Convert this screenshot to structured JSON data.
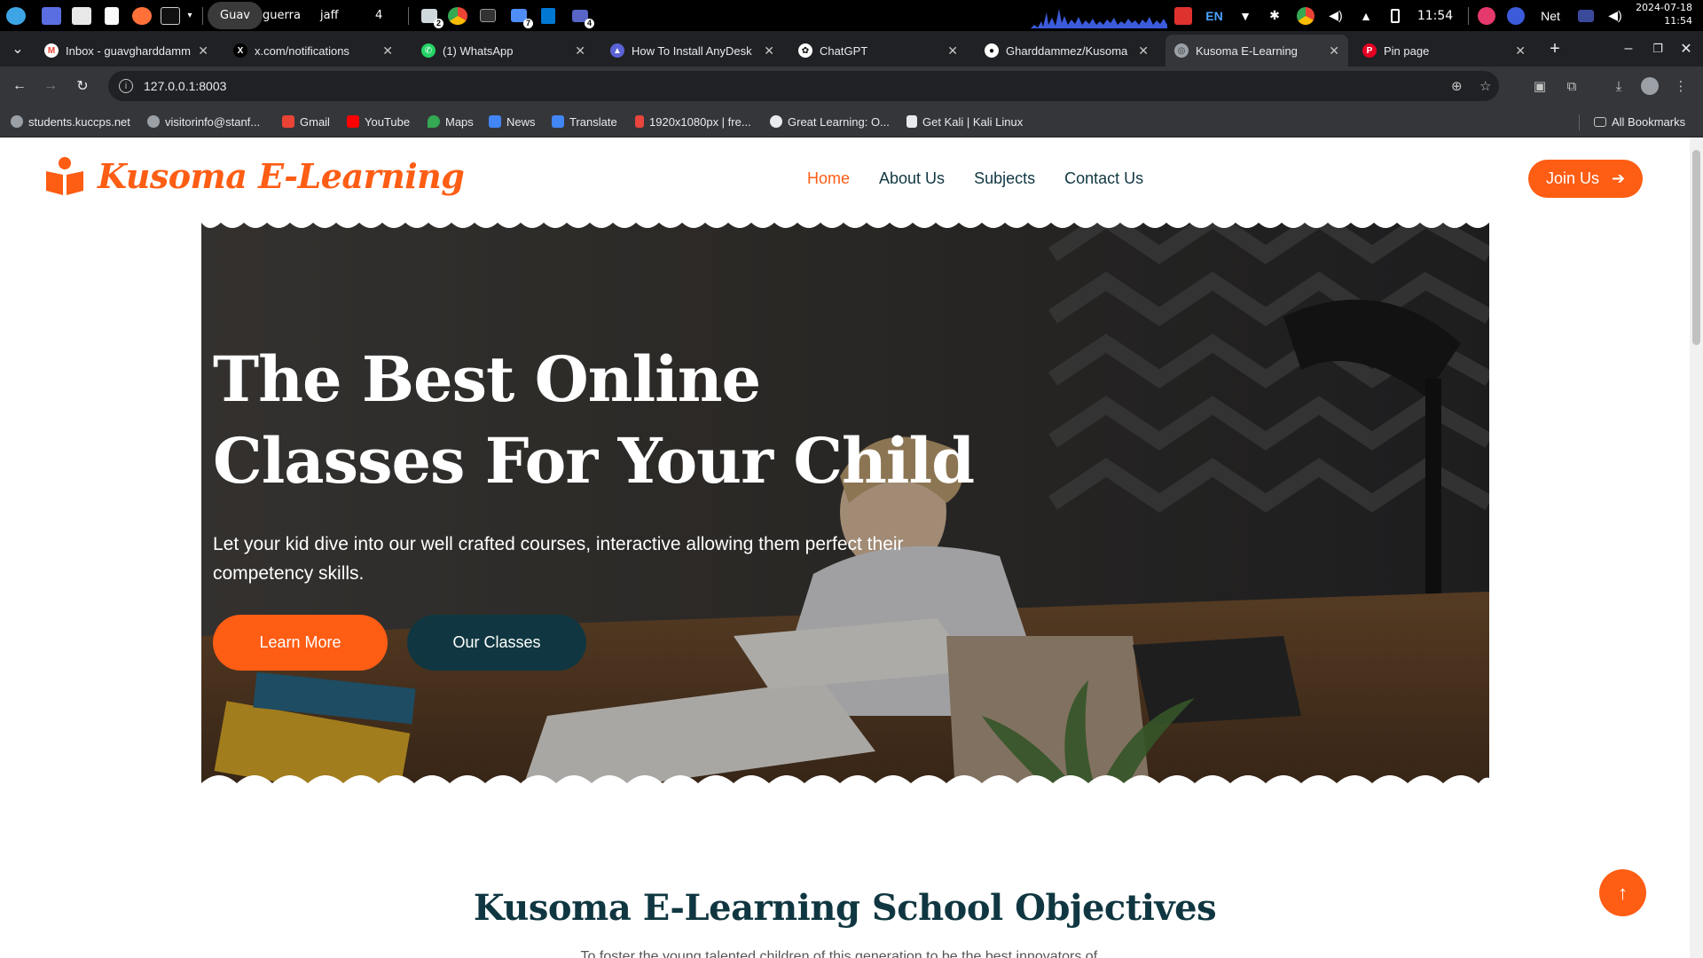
{
  "taskbar": {
    "workspaces": [
      "Guav",
      "guerra",
      "jaff",
      "4"
    ],
    "badges": [
      "2",
      "7",
      "4"
    ],
    "lang": "EN",
    "time": "11:54",
    "net_label": "Net",
    "date": "2024-07-18",
    "clock_time": "11:54"
  },
  "tabs": [
    {
      "title": "Inbox - guavgharddammez@",
      "active": false
    },
    {
      "title": "x.com/notifications",
      "active": false
    },
    {
      "title": "(1) WhatsApp",
      "active": false
    },
    {
      "title": "How To Install AnyDesk",
      "active": false
    },
    {
      "title": "ChatGPT",
      "active": false
    },
    {
      "title": "Gharddammez/Kusoma",
      "active": false
    },
    {
      "title": "Kusoma E-Learning",
      "active": true
    },
    {
      "title": "Pin page",
      "active": false
    }
  ],
  "new_tab_label": "+",
  "address": {
    "url": "127.0.0.1:8003"
  },
  "bookmarks": [
    "students.kuccps.net",
    "visitorinfo@stanf...",
    "Gmail",
    "YouTube",
    "Maps",
    "News",
    "Translate",
    "1920x1080px | fre...",
    "Great Learning: O...",
    "Get Kali | Kali Linux"
  ],
  "all_bookmarks_label": "All Bookmarks",
  "site": {
    "logo_text": "Kusoma E-Learning",
    "nav": [
      "Home",
      "About Us",
      "Subjects",
      "Contact Us"
    ],
    "nav_active": "Home",
    "join_label": "Join Us",
    "hero": {
      "title": "The Best Online Classes For Your Child",
      "subtitle": "Let your kid dive into our well crafted courses, interactive allowing them perfect their competency skills.",
      "learn_more": "Learn More",
      "our_classes": "Our Classes"
    },
    "objectives_title": "Kusoma E-Learning School Objectives",
    "objectives_text": "To foster the young talented children of this generation to be the best innovators of..."
  },
  "colors": {
    "accent": "#fe5d14",
    "dark": "#103741"
  }
}
